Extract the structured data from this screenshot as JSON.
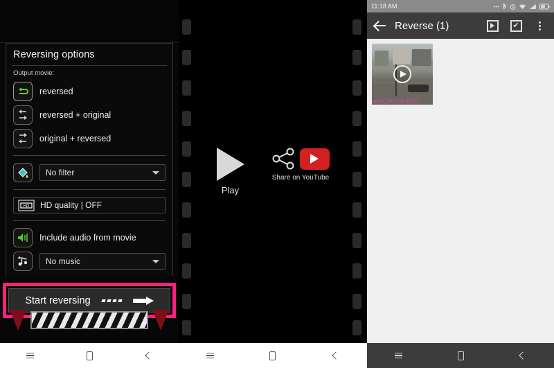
{
  "editor": {
    "panel_title": "Reversing options",
    "sub_label": "Output movie:",
    "modes": [
      {
        "label": "reversed",
        "icon": "loop-reverse-icon",
        "selected": true
      },
      {
        "label": "reversed + original",
        "icon": "reverse-then-forward-icon",
        "selected": false
      },
      {
        "label": "original + reversed",
        "icon": "forward-then-reverse-icon",
        "selected": false
      }
    ],
    "filter_select": {
      "value": "No filter",
      "icon": "paint-bucket-icon"
    },
    "hd_row": {
      "value": "HD quality | OFF",
      "icon": "hd-film-icon"
    },
    "audio_row": {
      "value": "Include audio from movie",
      "icon": "speaker-icon"
    },
    "music_select": {
      "value": "No music",
      "icon": "music-note-add-icon"
    },
    "start_button": "Start reversing"
  },
  "player": {
    "play_label": "Play",
    "share_label": "Share on YouTube"
  },
  "gallery": {
    "status": {
      "time": "11:18 AM"
    },
    "appbar": {
      "title": "Reverse (1)",
      "back_icon": "back-arrow-icon",
      "play_icon": "play-box-icon",
      "select_icon": "checkbox-checked-icon",
      "overflow_icon": "more-vertical-icon"
    },
    "items": [
      {
        "filename": "video_2018-09-10T11",
        "play_icon": "play-circle-icon"
      }
    ]
  },
  "navbars": [
    {
      "theme": "light",
      "menu": "menu-icon",
      "home": "home-icon",
      "back": "back-icon"
    },
    {
      "theme": "light",
      "menu": "menu-icon",
      "home": "home-icon",
      "back": "back-icon"
    },
    {
      "theme": "dark",
      "menu": "menu-icon",
      "home": "home-icon",
      "back": "back-icon"
    }
  ],
  "colors": {
    "highlight": "#ff1f81",
    "youtube_red": "#d32020",
    "filename_pink": "#e23bbd",
    "appbar": "#3c3c3c"
  }
}
